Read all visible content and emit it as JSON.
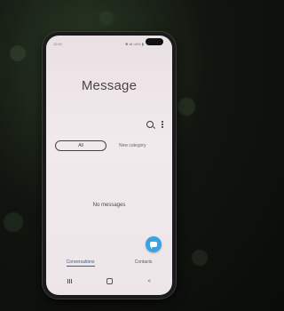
{
  "status_bar": {
    "time": "12:01",
    "icons": "✱ ⋈ 44% ▮"
  },
  "app": {
    "title": "Message"
  },
  "toolbar": {
    "search_icon": "search-icon",
    "more_icon": "more-vertical-icon"
  },
  "categories": {
    "all_label": "All",
    "new_category_label": "New category"
  },
  "empty_state": {
    "text": "No messages"
  },
  "compose": {
    "icon": "chat-compose-icon",
    "color": "#3aa3e0"
  },
  "bottom_tabs": [
    {
      "label": "Conversations",
      "active": true
    },
    {
      "label": "Contacts",
      "active": false
    }
  ],
  "nav_bar": {
    "back_glyph": "<"
  },
  "colors": {
    "accent": "#2d5fa8",
    "screen_bg": "#efe7ea"
  }
}
